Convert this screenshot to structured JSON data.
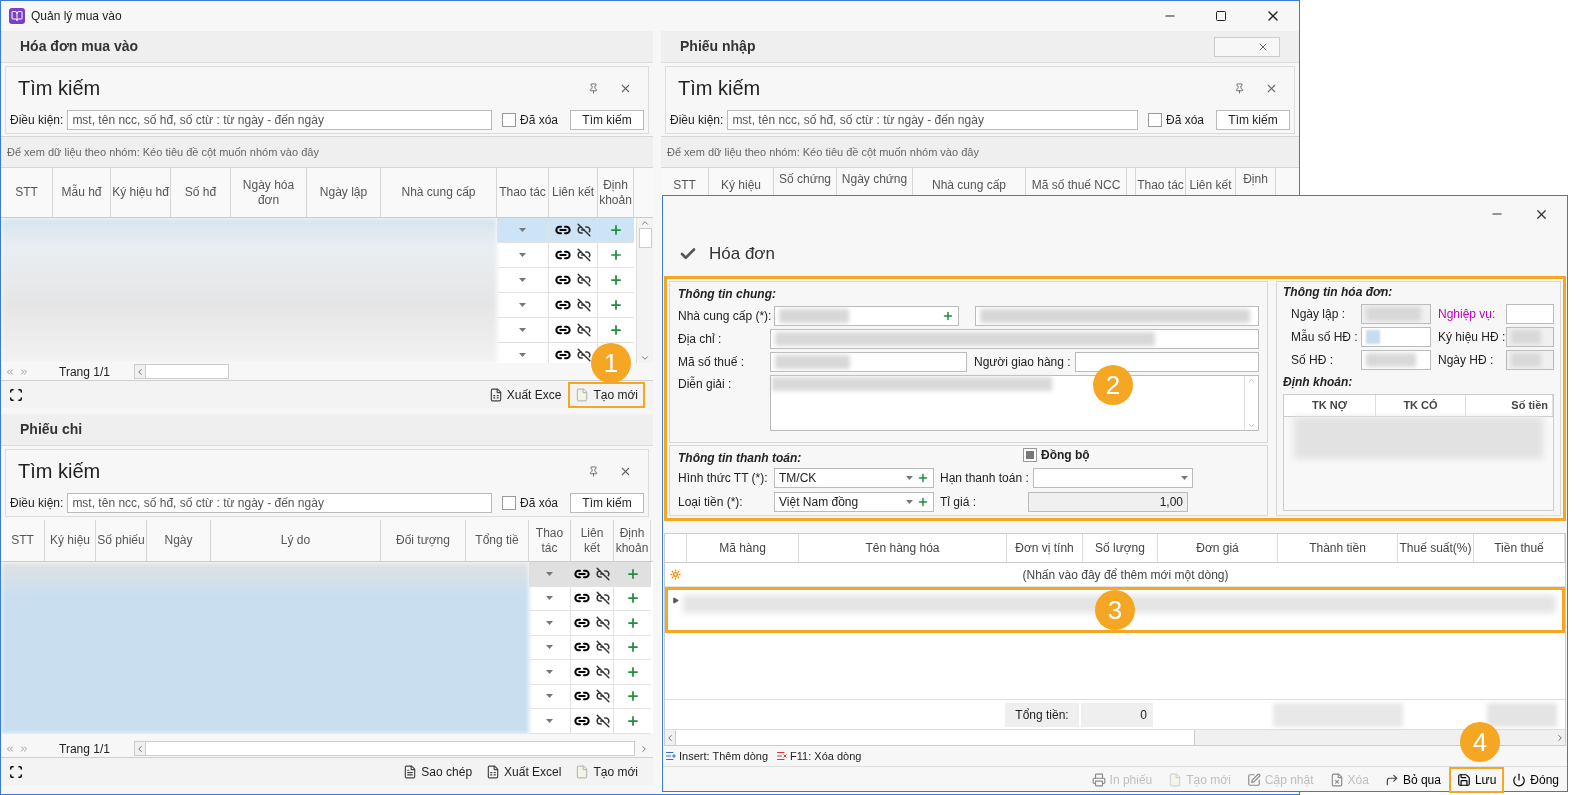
{
  "window": {
    "title": "Quản lý mua vào"
  },
  "invoices": {
    "title": "Hóa đơn mua vào",
    "search": {
      "title": "Tìm kiếm",
      "condition_label": "Điều kiện:",
      "placeholder": "mst, tên ncc, số hđ, số ctừ : từ ngày - đến ngày",
      "deleted_label": "Đã xóa",
      "deleted_checked": false,
      "button": "Tìm kiếm"
    },
    "group_hint": "Để xem dữ liệu theo nhóm: Kéo tiêu đề cột muốn nhóm vào đây",
    "columns": [
      "STT",
      "Mẫu hđ",
      "Ký hiệu hđ",
      "Số hđ",
      "Ngày hóa đơn",
      "Ngày lập",
      "Nhà cung cấp",
      "Thao tác",
      "Liên kết",
      "Định khoản"
    ],
    "rows": [
      {
        "selected": true
      },
      {
        "selected": false
      },
      {
        "selected": false
      },
      {
        "selected": false
      },
      {
        "selected": false
      },
      {
        "selected": false
      }
    ],
    "pager": "Trang 1/1",
    "buttons": [
      {
        "kind": "excel",
        "label": "Xuất Exce",
        "highlighted": false
      },
      {
        "kind": "new",
        "label": "Tạo mới",
        "highlighted": true
      }
    ]
  },
  "payments": {
    "title": "Phiếu chi",
    "search": {
      "title": "Tìm kiếm",
      "condition_label": "Điều kiện:",
      "placeholder": "mst, tên ncc, số hđ, số ctừ : từ ngày - đến ngày",
      "deleted_label": "Đã xóa",
      "deleted_checked": false,
      "button": "Tìm kiếm"
    },
    "columns": [
      "STT",
      "Ký hiệu",
      "Số phiếu",
      "Ngày",
      "Lý do",
      "Đối tượng",
      "Tổng tiề",
      "Thao tác",
      "Liên kết",
      "Định khoản"
    ],
    "rows": [
      {
        "selected": true
      },
      {
        "selected": false
      },
      {
        "selected": false
      },
      {
        "selected": false
      },
      {
        "selected": false
      },
      {
        "selected": false
      },
      {
        "selected": false
      }
    ],
    "pager": "Trang 1/1",
    "buttons": [
      {
        "kind": "copy",
        "label": "Sao chép",
        "highlighted": false
      },
      {
        "kind": "excel",
        "label": "Xuất Excel",
        "highlighted": false
      },
      {
        "kind": "new",
        "label": "Tạo mới",
        "highlighted": false
      }
    ]
  },
  "receipts": {
    "title": "Phiếu nhập",
    "search": {
      "title": "Tìm kiếm",
      "condition_label": "Điều kiện:",
      "placeholder": "mst, tên ncc, số hđ, số ctừ : từ ngày - đến ngày",
      "deleted_label": "Đã xóa",
      "deleted_checked": false,
      "button": "Tìm kiếm"
    },
    "group_hint": "Để xem dữ liệu theo nhóm: Kéo tiêu đề cột muốn nhóm vào đây",
    "columns": [
      "STT",
      "Ký hiệu",
      "Số chứng",
      "Ngày chứng",
      "Nhà cung cấp",
      "Mã số thuế NCC",
      "Thao tác",
      "Liên kết",
      "Định"
    ]
  },
  "dialog": {
    "heading": "Hóa đơn",
    "highlighted": true,
    "general": {
      "title": "Thông tin chung:",
      "supplier_label": "Nhà cung cấp (*):",
      "address_label": "Địa chỉ :",
      "tax_label": "Mã số thuế :",
      "deliverer_label": "Người giao hàng :",
      "note_label": "Diễn giải :"
    },
    "payment": {
      "title": "Thông tin thanh toán:",
      "sync_label": "Đồng bộ",
      "sync_checked": true,
      "method_label": "Hình thức TT (*):",
      "method_value": "TM/CK",
      "due_label": "Hạn thanh toán :",
      "currency_label": "Loại tiền (*):",
      "currency_value": "Việt Nam đồng",
      "rate_label": "Tỉ giá :",
      "rate_value": "1,00"
    },
    "invoice_info": {
      "title": "Thông tin hóa đơn:",
      "date_label": "Ngày lập :",
      "business_label": "Nghiệp vụ:",
      "form_label": "Mẫu số HĐ :",
      "symbol_label": "Ký hiệu HĐ :",
      "number_label": "Số HĐ :",
      "invoice_date_label": "Ngày HĐ :",
      "accounting_title": "Định khoản:",
      "accounting_columns": [
        "TK NỢ",
        "TK CÓ",
        "Số tiền"
      ]
    },
    "items": {
      "columns": [
        "Mã hàng",
        "Tên hàng hóa",
        "Đơn vị tính",
        "Số lượng",
        "Đơn giá",
        "Thành tiền",
        "Thuế suất(%)",
        "Tiền thuế"
      ],
      "new_row_hint": "(Nhấn vào đây để thêm mới một dòng)",
      "row_highlighted": true,
      "total_label": "Tổng tiền:",
      "total_value": "0"
    },
    "hints": [
      "Insert: Thêm dòng",
      "F11: Xóa dòng"
    ],
    "toolbar": [
      {
        "kind": "print",
        "label": "In phiếu",
        "disabled": true,
        "highlighted": false
      },
      {
        "kind": "new",
        "label": "Tạo mới",
        "disabled": true,
        "highlighted": false
      },
      {
        "kind": "edit",
        "label": "Cập nhật",
        "disabled": true,
        "highlighted": false
      },
      {
        "kind": "delete",
        "label": "Xóa",
        "disabled": true,
        "highlighted": false
      },
      {
        "kind": "skip",
        "label": "Bỏ qua",
        "disabled": false,
        "highlighted": false
      },
      {
        "kind": "save",
        "label": "Lưu",
        "disabled": false,
        "highlighted": true
      },
      {
        "kind": "close",
        "label": "Đóng",
        "disabled": false,
        "highlighted": false
      }
    ]
  },
  "callouts": [
    "1",
    "2",
    "3",
    "4"
  ]
}
